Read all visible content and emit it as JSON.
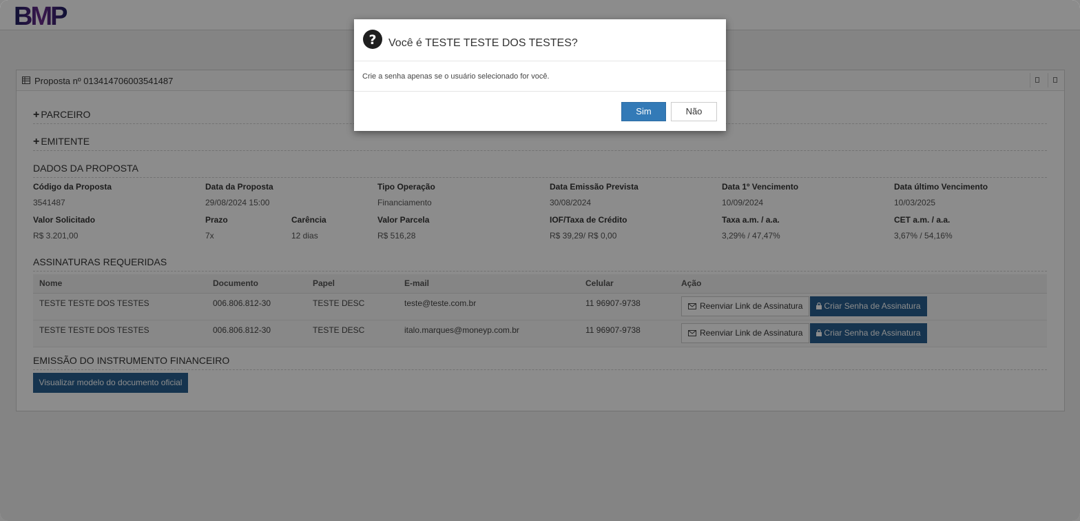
{
  "header": {
    "logo_text": "BMP"
  },
  "panel": {
    "title": "Proposta nº 013414706003541487",
    "sections": {
      "parceiro": "PARCEIRO",
      "emitente": "EMITENTE",
      "dados": "DADOS DA PROPOSTA",
      "assinaturas": "ASSINATURAS REQUERIDAS",
      "emissao": "EMISSÃO DO INSTRUMENTO FINANCEIRO"
    },
    "fields": {
      "codigo_label": "Código da Proposta",
      "codigo_value": "3541487",
      "data_label": "Data da Proposta",
      "data_value": "29/08/2024 15:00",
      "tipo_label": "Tipo Operação",
      "tipo_value": "Financiamento",
      "emissao_label": "Data Emissão Prevista",
      "emissao_value": "30/08/2024",
      "venc1_label": "Data 1º Vencimento",
      "venc1_value": "10/09/2024",
      "vencult_label": "Data último Vencimento",
      "vencult_value": "10/03/2025",
      "valor_label": "Valor Solicitado",
      "valor_value": "R$ 3.201,00",
      "prazo_label": "Prazo",
      "prazo_value": "7x",
      "carencia_label": "Carência",
      "carencia_value": "12 dias",
      "parcela_label": "Valor Parcela",
      "parcela_value": "R$ 516,28",
      "iof_label": "IOF/Taxa de Crédito",
      "iof_value": "R$ 39,29/ R$ 0,00",
      "taxa_label": "Taxa a.m. / a.a.",
      "taxa_value": "3,29% / 47,47%",
      "cet_label": "CET a.m. / a.a.",
      "cet_value": "3,67% / 54,16%"
    },
    "table": {
      "headers": [
        "Nome",
        "Documento",
        "Papel",
        "E-mail",
        "Celular",
        "Ação"
      ],
      "rows": [
        {
          "nome": "TESTE TESTE DOS TESTES",
          "documento": "006.806.812-30",
          "papel": "TESTE DESC",
          "email": "teste@teste.com.br",
          "celular": "11 96907-9738"
        },
        {
          "nome": "TESTE TESTE DOS TESTES",
          "documento": "006.806.812-30",
          "papel": "TESTE DESC",
          "email": "italo.marques@moneyp.com.br",
          "celular": "11 96907-9738"
        }
      ],
      "reenviar_label": "Reenviar Link de Assinatura",
      "criar_label": "Criar Senha de Assinatura"
    },
    "view_button": "Visualizar modelo do documento oficial"
  },
  "modal": {
    "title": "Você é TESTE TESTE DOS TESTES?",
    "body": "Crie a senha apenas se o usuário selecionado for você.",
    "yes_label": "Sim",
    "no_label": "Não"
  },
  "colors": {
    "primary": "#337ab7",
    "dark_blue": "#286090",
    "logo_navy": "#1a1f5e",
    "logo_purple": "#6a2a8c"
  },
  "icons": [
    "table-icon",
    "question-circle-icon",
    "envelope-icon",
    "lock-icon",
    "plus-icon"
  ]
}
